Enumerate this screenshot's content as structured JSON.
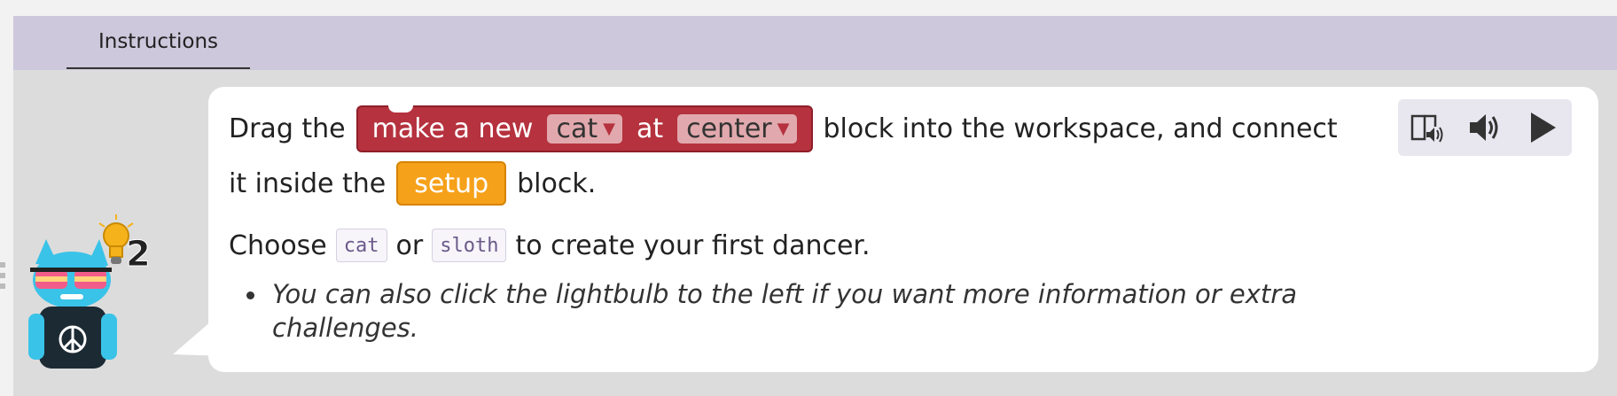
{
  "header": {
    "tab_label": "Instructions"
  },
  "instructions": {
    "line1_pre": "Drag the",
    "block_make": {
      "label": "make a new",
      "dropdown1": "cat",
      "mid": "at",
      "dropdown2": "center",
      "arrow": "▼"
    },
    "line1_post": "block into the workspace, and connect",
    "line2_pre": "it inside the",
    "block_setup": "setup",
    "line2_post": "block.",
    "line3_pre": "Choose",
    "code1": "cat",
    "line3_mid": "or",
    "code2": "sloth",
    "line3_post": "to create your first dancer.",
    "bullet": "You can also click the lightbulb to the left if you want more information or extra challenges."
  },
  "hint": {
    "count": "2"
  },
  "media": {
    "buttons": [
      "immersive-reader-icon",
      "speaker-icon",
      "play-icon"
    ]
  },
  "colors": {
    "header_bg": "#cdc8dc",
    "block_red": "#b5323e",
    "block_orange": "#f6a11a"
  }
}
